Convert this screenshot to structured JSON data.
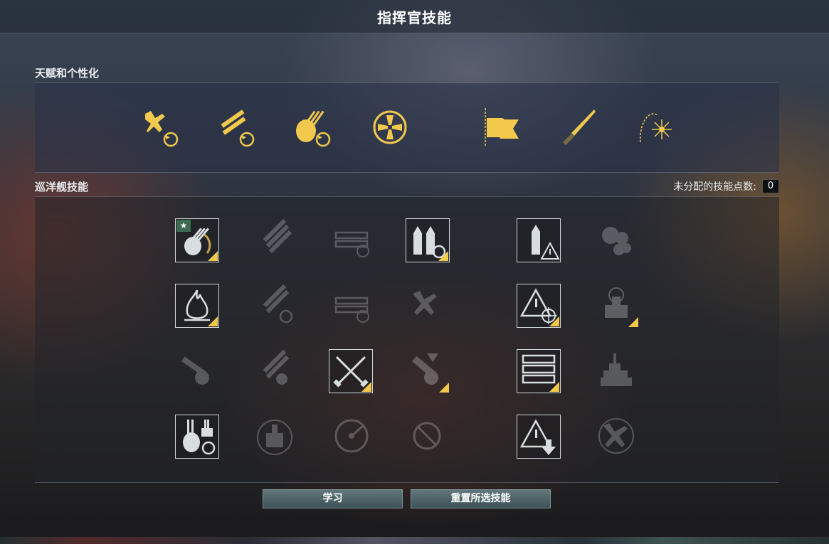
{
  "window": {
    "title": "指挥官技能"
  },
  "talents": {
    "header": "天赋和个性化",
    "icons": [
      "plane-reload-icon",
      "torpedo-reload-icon",
      "turret-reload-icon",
      "crosshair-emblem-icon",
      "flag-icon",
      "knife-icon",
      "firework-icon"
    ]
  },
  "skills": {
    "header": "巡洋舰技能",
    "points_label": "未分配的技能点数:",
    "points_value": "0",
    "rows": [
      [
        "main-battery-reload-icon",
        "torpedo-rack-icon",
        "torpedo-armament-icon",
        "shell-reload-icon",
        "shell-warning-icon",
        "ship-engine-icon"
      ],
      [
        "fire-icon",
        "torpedo-reload-icon",
        "torpedo-acceleration-icon",
        "aircraft-icon",
        "warning-target-icon",
        "radar-ship-icon"
      ],
      [
        "aa-defense-icon",
        "torpedo-aa-icon",
        "crossed-swords-icon",
        "bomb-ap-icon",
        "armored-cargo-icon",
        "superstructure-icon"
      ],
      [
        "turret-rotate-icon",
        "ship-crosshair-icon",
        "radio-locator-icon",
        "no-entry-icon",
        "warning-down-icon",
        "aircraft-crosshair-icon"
      ]
    ],
    "states": [
      [
        "learned-star",
        "dim",
        "dim",
        "learned",
        "learned",
        "dim"
      ],
      [
        "learned",
        "dim",
        "dim",
        "dim",
        "learned",
        "dim-tri"
      ],
      [
        "dim",
        "dim",
        "learned",
        "dim-tri",
        "learned",
        "dim"
      ],
      [
        "learned",
        "dim",
        "dim",
        "dim",
        "learned",
        "dim"
      ]
    ]
  },
  "buttons": {
    "learn": "学习",
    "reset": "重置所选技能"
  },
  "colors": {
    "accent": "#f2c94c",
    "button": "#4e6468"
  }
}
